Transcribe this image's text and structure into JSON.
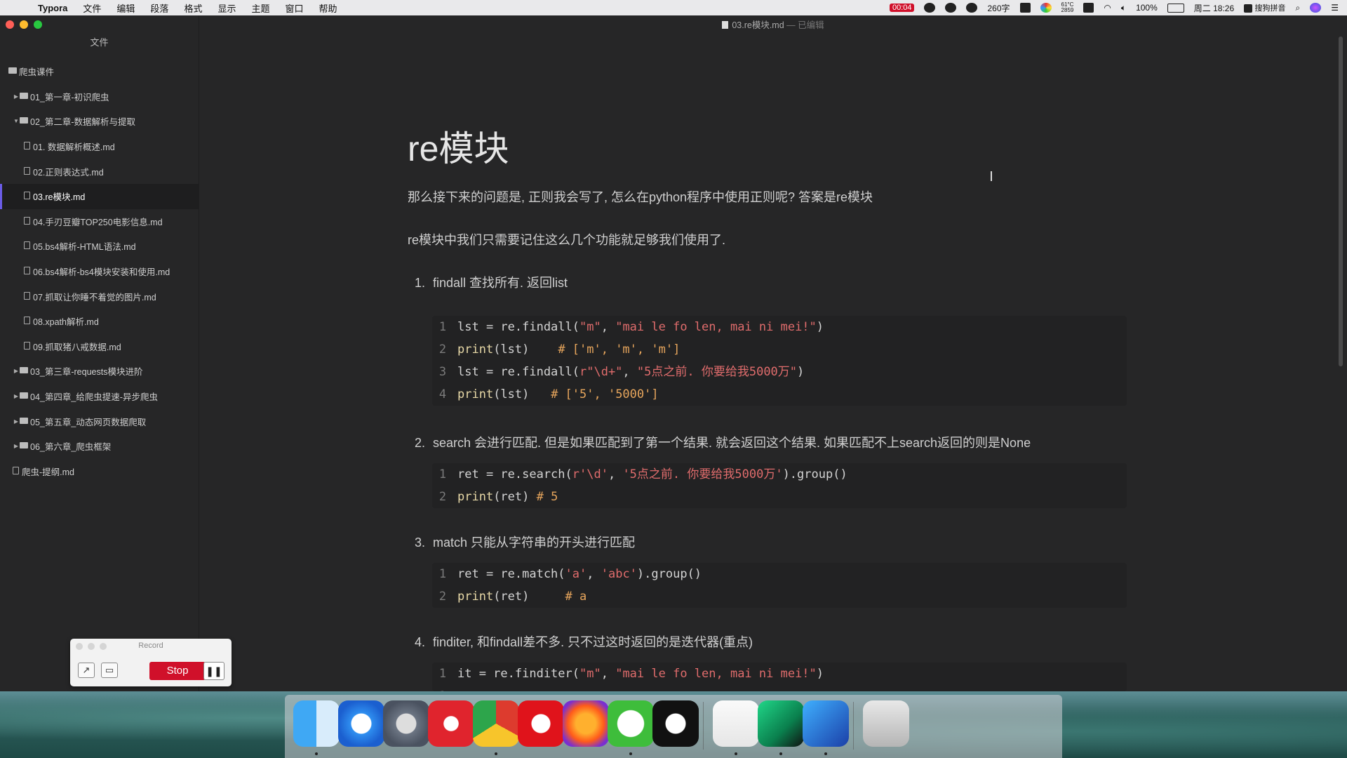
{
  "menubar": {
    "app_name": "Typora",
    "items": [
      "文件",
      "编辑",
      "段落",
      "格式",
      "显示",
      "主题",
      "窗口",
      "帮助"
    ],
    "record_time": "00:04",
    "word_count": "260字",
    "cpu_temp": "61°C",
    "cpu_fan": "2859",
    "battery": "100%",
    "datetime": "周二 18:26",
    "ime": "搜狗拼音"
  },
  "sidebar": {
    "title": "文件",
    "tree": [
      {
        "label": "爬虫课件",
        "type": "folder",
        "depth": 0,
        "caret": ""
      },
      {
        "label": "01_第一章-初识爬虫",
        "type": "folder",
        "depth": 1,
        "caret": "▶"
      },
      {
        "label": "02_第二章-数据解析与提取",
        "type": "folder",
        "depth": 1,
        "caret": "▼"
      },
      {
        "label": "01. 数据解析概述.md",
        "type": "file",
        "depth": 2
      },
      {
        "label": "02.正则表达式.md",
        "type": "file",
        "depth": 2
      },
      {
        "label": "03.re模块.md",
        "type": "file",
        "depth": 2,
        "active": true
      },
      {
        "label": "04.手刃豆瓣TOP250电影信息.md",
        "type": "file",
        "depth": 2
      },
      {
        "label": "05.bs4解析-HTML语法.md",
        "type": "file",
        "depth": 2
      },
      {
        "label": "06.bs4解析-bs4模块安装和使用.md",
        "type": "file",
        "depth": 2
      },
      {
        "label": "07.抓取让你睡不着觉的图片.md",
        "type": "file",
        "depth": 2
      },
      {
        "label": "08.xpath解析.md",
        "type": "file",
        "depth": 2
      },
      {
        "label": "09.抓取猪八戒数据.md",
        "type": "file",
        "depth": 2
      },
      {
        "label": "03_第三章-requests模块进阶",
        "type": "folder",
        "depth": 1,
        "caret": "▶"
      },
      {
        "label": "04_第四章_给爬虫提速-异步爬虫",
        "type": "folder",
        "depth": 1,
        "caret": "▶"
      },
      {
        "label": "05_第五章_动态网页数据爬取",
        "type": "folder",
        "depth": 1,
        "caret": "▶"
      },
      {
        "label": "06_第六章_爬虫框架",
        "type": "folder",
        "depth": 1,
        "caret": "▶"
      },
      {
        "label": "爬虫-提纲.md",
        "type": "file",
        "depth": 1
      }
    ]
  },
  "editor": {
    "file_name": "03.re模块.md",
    "state": " — 已编辑",
    "heading": "re模块",
    "para1": "那么接下来的问题是, 正则我会写了, 怎么在python程序中使用正则呢? 答案是re模块",
    "para2": "re模块中我们只需要记住这么几个功能就足够我们使用了.",
    "items": [
      {
        "num": "1.",
        "text": "findall 查找所有. 返回list"
      },
      {
        "num": "2.",
        "text": "search 会进行匹配. 但是如果匹配到了第一个结果. 就会返回这个结果. 如果匹配不上search返回的则是None"
      },
      {
        "num": "3.",
        "text": "match  只能从字符串的开头进行匹配"
      },
      {
        "num": "4.",
        "text": "finditer,  和findall差不多. 只不过这时返回的是迭代器(重点)"
      }
    ]
  },
  "recorder": {
    "title": "Record",
    "stop_label": "Stop",
    "pause_label": "❚❚"
  },
  "dock_apps": [
    "Finder",
    "Safari",
    "Launchpad",
    "NetEase Music",
    "Chrome",
    "Opera",
    "Firefox",
    "WeChat",
    "QQ",
    "Typora",
    "PyCharm",
    "Thunder",
    "Trash"
  ]
}
